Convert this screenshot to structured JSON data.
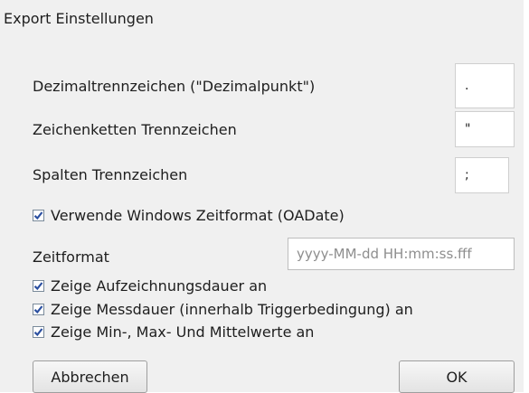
{
  "dialog": {
    "title": "Export Einstellungen",
    "decimal_separator": {
      "label": "Dezimaltrennzeichen (\"Dezimalpunkt\")",
      "value": "."
    },
    "string_separator": {
      "label": "Zeichenketten Trennzeichen",
      "value": "\""
    },
    "column_separator": {
      "label": "Spalten Trennzeichen",
      "value": ";"
    },
    "windows_time_format": {
      "label": "Verwende Windows Zeitformat (OADate)",
      "checked": true
    },
    "time_format": {
      "label": "Zeitformat",
      "placeholder": "yyyy-MM-dd HH:mm:ss.fff"
    },
    "show_recording_duration": {
      "label": "Zeige Aufzeichnungsdauer an",
      "checked": true
    },
    "show_measurement_duration": {
      "label": "Zeige Messdauer (innerhalb Triggerbedingung) an",
      "checked": true
    },
    "show_min_max_mean": {
      "label": "Zeige Min-, Max- Und Mittelwerte an",
      "checked": true
    },
    "cancel_label": "Abbrechen",
    "ok_label": "OK"
  }
}
